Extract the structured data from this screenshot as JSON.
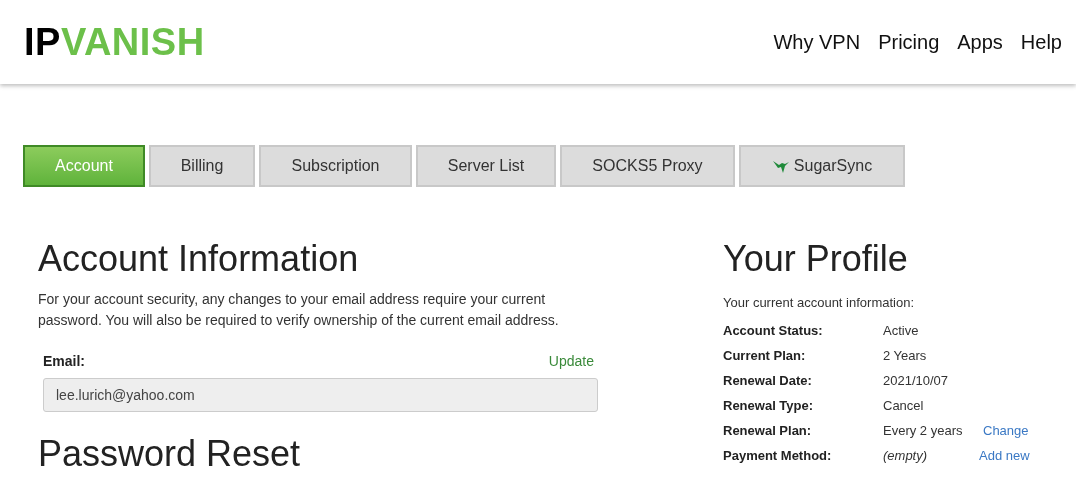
{
  "logo": {
    "part_1": "IP",
    "part_2": "VANISH"
  },
  "nav": [
    "Why VPN",
    "Pricing",
    "Apps",
    "Help"
  ],
  "tabs": [
    {
      "label": "Account",
      "selected": true,
      "kind": "text"
    },
    {
      "label": "Billing",
      "selected": false,
      "kind": "text"
    },
    {
      "label": "Subscription",
      "selected": false,
      "kind": "text"
    },
    {
      "label": "Server List",
      "selected": false,
      "kind": "text"
    },
    {
      "label": "SOCKS5 Proxy",
      "selected": false,
      "kind": "text"
    },
    {
      "label": "SugarSync",
      "selected": false,
      "kind": "with-icon"
    }
  ],
  "account": {
    "title": "Account Information",
    "text": "For your account security, any changes to your email address require your current password. You will also be required to verify ownership of the current email address.",
    "email_label": "Email:",
    "update_link": "Update",
    "email_value": "lee.lurich@yahoo.com"
  },
  "password": {
    "title": "Password Reset"
  },
  "profile": {
    "title": "Your Profile",
    "subtitle": "Your current account information:",
    "rows": [
      {
        "label": "Account Status:",
        "value": "Active",
        "kind": "plain"
      },
      {
        "label": "Current Plan:",
        "value": "2 Years",
        "kind": "plain"
      },
      {
        "label": "Renewal Date:",
        "value": "2021/10/07",
        "kind": "plain"
      },
      {
        "label": "Renewal Type:",
        "value": "Cancel",
        "kind": "plain"
      },
      {
        "label": "Renewal Plan:",
        "value": "Every 2 years",
        "kind": "plain",
        "link": "Change"
      },
      {
        "label": "Payment Method:",
        "value": "(empty)",
        "kind": "empty",
        "link": "Add new"
      }
    ]
  }
}
